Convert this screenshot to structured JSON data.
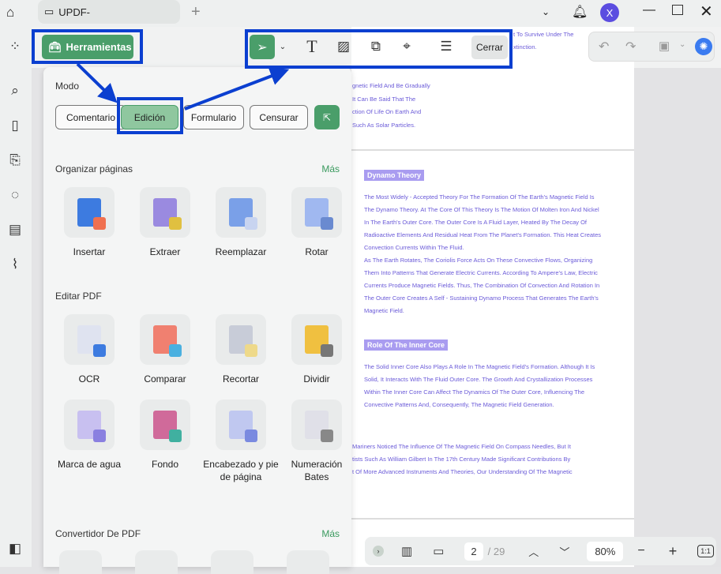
{
  "window": {
    "tab_title": "UPDF-",
    "avatar_letter": "X"
  },
  "toolbar": {
    "tools_button": "Herramientas",
    "close_button": "Cerrar"
  },
  "panel": {
    "mode_label": "Modo",
    "modes": [
      "Comentario",
      "Edición",
      "Formulario",
      "Censurar"
    ],
    "organize": {
      "title": "Organizar páginas",
      "more": "Más",
      "items": [
        "Insertar",
        "Extraer",
        "Reemplazar",
        "Rotar"
      ]
    },
    "edit": {
      "title": "Editar PDF",
      "items": [
        "OCR",
        "Comparar",
        "Recortar",
        "Dividir",
        "Marca de agua",
        "Fondo",
        "Encabezado y pie de página",
        "Numeración Bates"
      ]
    },
    "convert": {
      "title": "Convertidor De PDF",
      "more": "Más"
    }
  },
  "document": {
    "top_lines": [
      "t To Survive Under The",
      "xtinction."
    ],
    "lines_a": [
      "gnetic Field And Be Gradually",
      "It Can Be Said That The",
      "ction Of Life On Earth And",
      "Such As Solar Particles."
    ],
    "heading1": "Dynamo Theory",
    "para1": [
      "The Most Widely - Accepted Theory For The Formation Of The Earth's Magnetic Field Is",
      "The Dynamo Theory. At The Core Of This Theory Is The Motion Of Molten Iron And Nickel",
      "In The Earth's Outer Core. The Outer Core Is A Fluid Layer, Heated By The Decay Of",
      "Radioactive Elements And Residual Heat From The Planet's Formation. This Heat Creates",
      "Convection Currents Within The Fluid.",
      "As The Earth Rotates, The Coriolis Force Acts On These Convective Flows, Organizing",
      "Them Into Patterns That Generate Electric Currents. According To Ampere's Law, Electric",
      "Currents Produce Magnetic Fields. Thus, The Combination Of Convection And Rotation In",
      "The Outer Core Creates A Self - Sustaining Dynamo Process That Generates The Earth's",
      "Magnetic Field."
    ],
    "heading2": "Role Of The Inner Core",
    "para2": [
      "The Solid Inner Core Also Plays A Role In The Magnetic Field's Formation. Although It Is",
      "Solid, It Interacts With The Fluid Outer Core. The Growth And Crystallization Processes",
      "Within The Inner Core Can Affect The Dynamics Of The Outer Core, Influencing The",
      "Convective Patterns And, Consequently, The Magnetic Field Generation."
    ],
    "para3": [
      "Mariners Noticed The Influence Of The Magnetic Field On Compass Needles, But It",
      "tists Such As William Gilbert In The 17th Century Made Significant Contributions By",
      "t Of More Advanced Instruments And Theories, Our Understanding Of The Magnetic"
    ]
  },
  "pager": {
    "current_page": "2",
    "total": "/ 29",
    "zoom": "80%",
    "fit": "1:1"
  },
  "colors": {
    "accent": "#4a9e6a",
    "annotation": "#0b3fd0",
    "doc_text": "#6a5ad8"
  }
}
